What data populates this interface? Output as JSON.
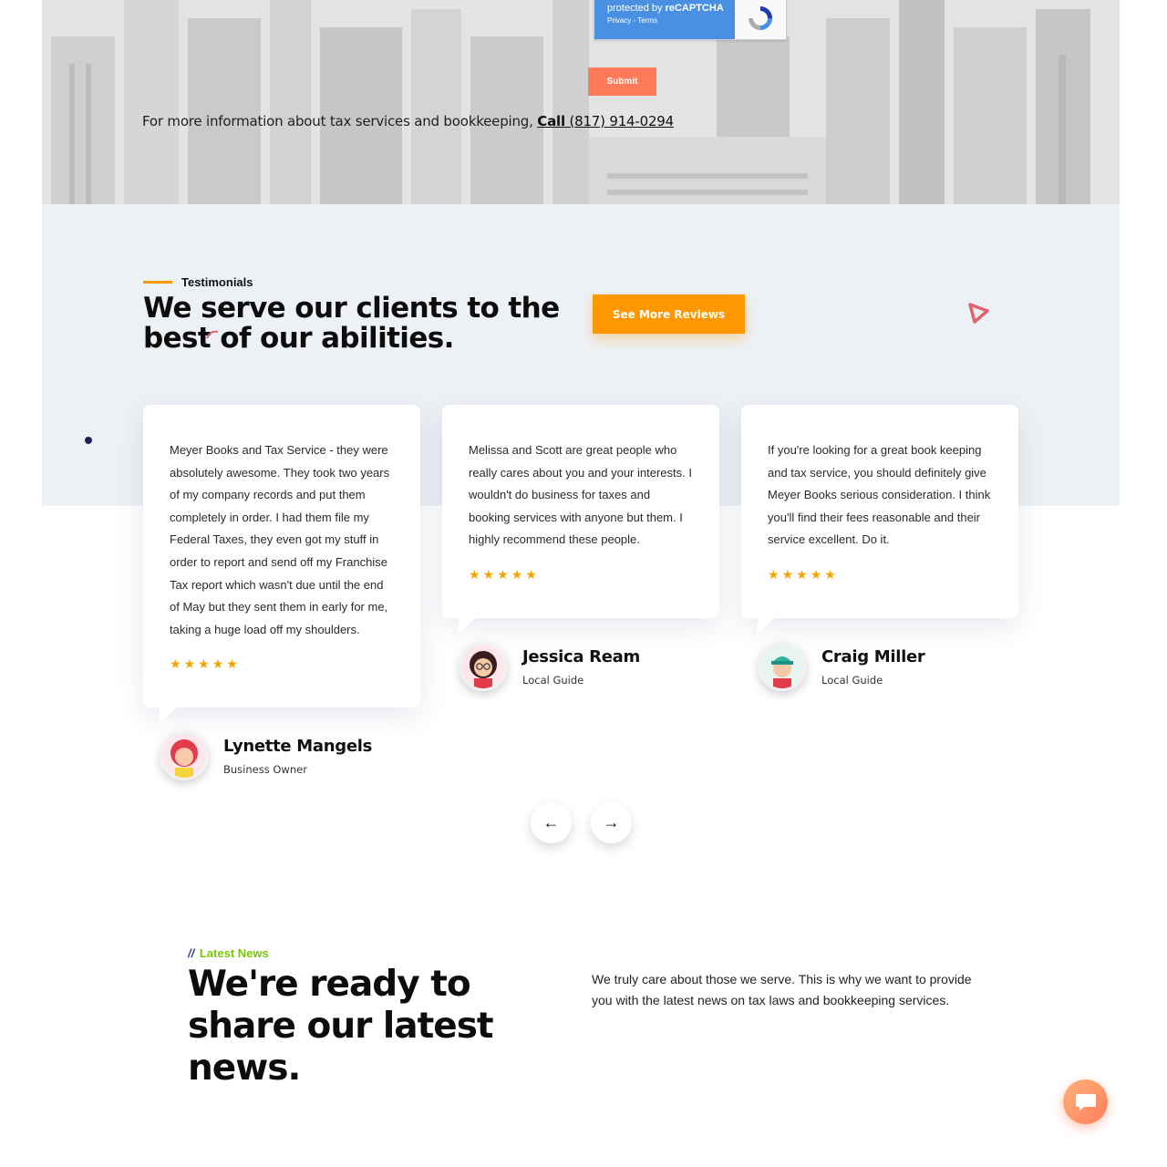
{
  "hero": {
    "recaptcha_line1_prefix": "protected by ",
    "recaptcha_line1_brand": "reCAPTCHA",
    "recaptcha_line2": "Privacy - Terms",
    "submit_label": "Submit",
    "info_text": "For more information about tax services and bookkeeping, ",
    "call_label": "Call",
    "phone": "(817) 914-0294"
  },
  "testimonials": {
    "eyebrow": "Testimonials",
    "title": "We serve our clients to the best of our abilities.",
    "more_button": "See More Reviews",
    "reviews": [
      {
        "text": "Meyer Books and Tax Service - they were absolutely awesome. They took two years of my company records and put them completely in order. I had them file my Federal Taxes, they even got my stuff in order to report and send off my Franchise Tax report which wasn't due until the end of May but they sent them in early for me, taking a huge load off my shoulders.",
        "rating": 5,
        "name": "Lynette Mangels",
        "role": "Business Owner"
      },
      {
        "text": "Melissa and Scott are great people who really cares about you and your interests. I wouldn't do business for taxes and booking services with anyone but them. I highly recommend these people.",
        "rating": 5,
        "name": "Jessica Ream",
        "role": "Local Guide"
      },
      {
        "text": "If you're looking for a great book keeping and tax service, you should definitely give Meyer Books serious consideration. I think you'll find their fees reasonable and their service excellent. Do it.",
        "rating": 5,
        "name": "Craig Miller",
        "role": "Local Guide"
      }
    ],
    "prev_icon": "arrow-left-icon",
    "next_icon": "arrow-right-icon"
  },
  "news": {
    "eyebrow_slashes": "//",
    "eyebrow": "Latest News",
    "title": "We're ready to share our latest news.",
    "description": "We truly care about those we serve. This is why we want to provide you with the latest news on tax laws and bookkeeping services."
  },
  "colors": {
    "accent_orange": "#ff9800",
    "submit_coral": "#ff7a59",
    "testimonial_bg": "#edf1f5",
    "news_green": "#7ac70c",
    "star": "#f5a400"
  },
  "chat": {
    "icon": "chat-icon"
  }
}
